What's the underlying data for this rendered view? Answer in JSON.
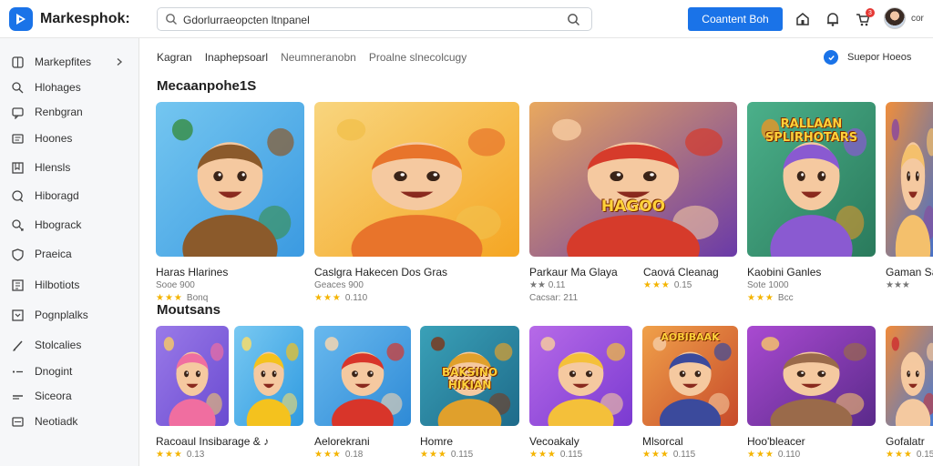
{
  "app": {
    "brand": "Markesphok:"
  },
  "search": {
    "value": "Gdorlurraeopcten ltnpanel",
    "placeholder": ""
  },
  "header": {
    "cta_label": "Coantent Boh",
    "notification_count": "3",
    "user_name": "cor"
  },
  "sidebar": {
    "items": [
      {
        "label": "Markepfites",
        "icon": "grid-icon"
      },
      {
        "label": "Hlohages",
        "icon": "search-icon"
      },
      {
        "label": "Renbgran",
        "icon": "message-icon"
      },
      {
        "label": "Hoones",
        "icon": "chat-icon"
      },
      {
        "label": "Hlensls",
        "icon": "bookmark-icon"
      },
      {
        "label": "Hiboragd",
        "icon": "bubble-icon"
      },
      {
        "label": "Hbograck",
        "icon": "pen-icon"
      },
      {
        "label": "Praeica",
        "icon": "shield-icon"
      },
      {
        "label": "Hilbotiots",
        "icon": "book-icon"
      },
      {
        "label": "Pognplalks",
        "icon": "box-icon"
      },
      {
        "label": "Stolcalies",
        "icon": "brush-icon"
      },
      {
        "label": "Dnogint",
        "icon": "dots-icon"
      },
      {
        "label": "Siceora",
        "icon": "line-icon"
      },
      {
        "label": "Neotiadk",
        "icon": "tag-icon"
      }
    ]
  },
  "tabs": [
    {
      "label": "Kagran"
    },
    {
      "label": "Inaphepsoarl"
    },
    {
      "label": "Neumneranobn"
    },
    {
      "label": "Proalne slnecolcugy"
    }
  ],
  "support_label": "Suepor Hoeos",
  "section1": {
    "title": "Mecaanpohe1S",
    "cards": [
      {
        "title": "Haras Hlarines",
        "line1": "Sooe 900",
        "line2": "Bonq",
        "stars": "★★★",
        "art": "boy-cat"
      },
      {
        "title": "Caslgra Hakecen Dos Gras",
        "line1": "Geaces 900",
        "line2": "0.110",
        "stars": "★★★",
        "art": "girl"
      },
      {
        "title": "Parkaur Ma Glaya",
        "line1": "★★ 0.11",
        "line2": "Cacsar: 211",
        "stars": "",
        "art": "hero",
        "banner": "HAGOO"
      },
      {
        "title": "Caová Cleanag",
        "line1": "0.15",
        "line2": "",
        "stars": "★★★",
        "art": "orange"
      },
      {
        "title": "Kaobini Ganles",
        "line1": "Sote 1000",
        "line2": "Bcc",
        "stars": "★★★",
        "art": "pets",
        "banner": "RALLAAN SPLIRHOTARS"
      },
      {
        "title": "Gaman Sa",
        "line1": "★★★",
        "line2": "",
        "stars": "",
        "art": "edge"
      }
    ]
  },
  "section2": {
    "title": "Moutsans",
    "cards": [
      {
        "title": "Racoaul Insibarage & ♪",
        "line1": "0.13",
        "stars": "★★★",
        "art": "purple"
      },
      {
        "title": "",
        "line1": "",
        "stars": "",
        "art": "bear"
      },
      {
        "title": "Aelorekrani",
        "line1": "0.18",
        "stars": "★★★",
        "art": "fox"
      },
      {
        "title": "Homre",
        "line1": "0.115",
        "stars": "★★★",
        "art": "casino",
        "banner": "BAKSINO HIKIAN"
      },
      {
        "title": "Vecoakaly",
        "line1": "0.115",
        "stars": "★★★",
        "art": "blonde"
      },
      {
        "title": "Mlsorcal",
        "line1": "0.115",
        "stars": "★★★",
        "art": "chef",
        "banner": "AOBIBAAK"
      },
      {
        "title": "Hoo'bleacer",
        "line1": "0.110",
        "stars": "★★★",
        "art": "wolf"
      },
      {
        "title": "Gofalatr",
        "line1": "0.15",
        "stars": "★★★",
        "art": "edge2"
      }
    ]
  },
  "colors": {
    "accent": "#1a73e8",
    "star": "#f4b400",
    "badge": "#e53935"
  }
}
